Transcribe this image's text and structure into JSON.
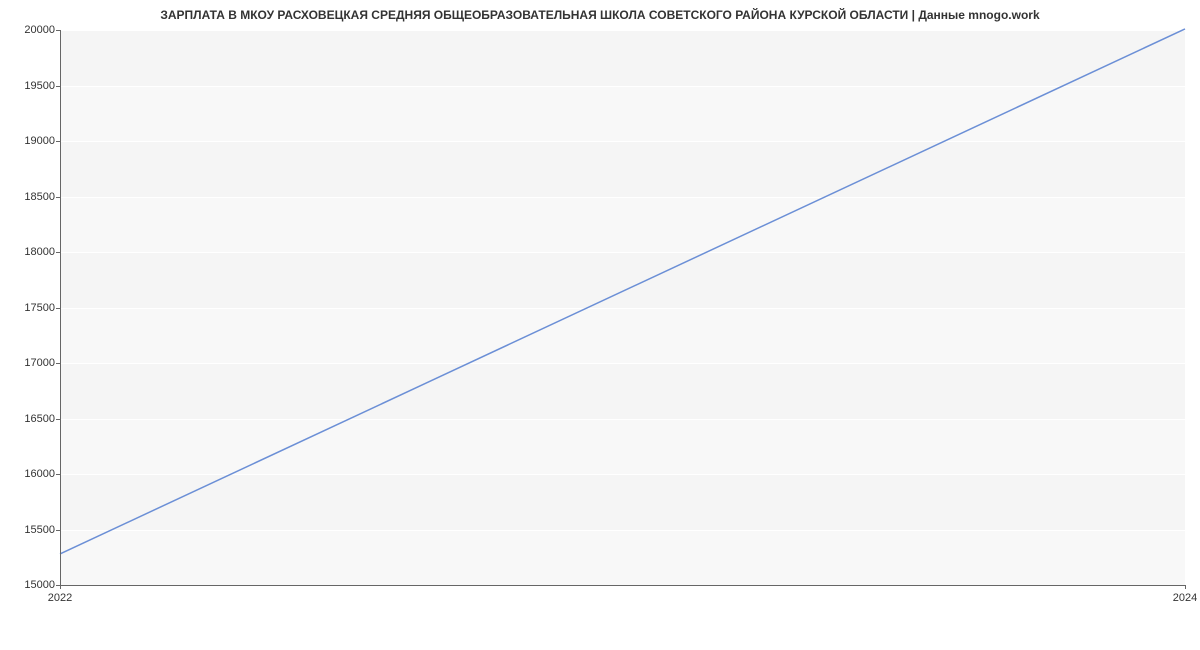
{
  "chart_data": {
    "type": "line",
    "title": "ЗАРПЛАТА В МКОУ РАСХОВЕЦКАЯ СРЕДНЯЯ ОБЩЕОБРАЗОВАТЕЛЬНАЯ ШКОЛА СОВЕТСКОГО РАЙОНА КУРСКОЙ ОБЛАСТИ | Данные mnogo.work",
    "xlabel": "",
    "ylabel": "",
    "x_ticks": [
      "2022",
      "2024"
    ],
    "y_ticks": [
      15000,
      15500,
      16000,
      16500,
      17000,
      17500,
      18000,
      18500,
      19000,
      19500,
      20000
    ],
    "xlim": [
      2022,
      2024
    ],
    "ylim": [
      15000,
      20000
    ],
    "series": [
      {
        "name": "salary",
        "color": "#6b8fd6",
        "x": [
          2022,
          2024
        ],
        "values": [
          15280,
          20010
        ]
      }
    ]
  }
}
